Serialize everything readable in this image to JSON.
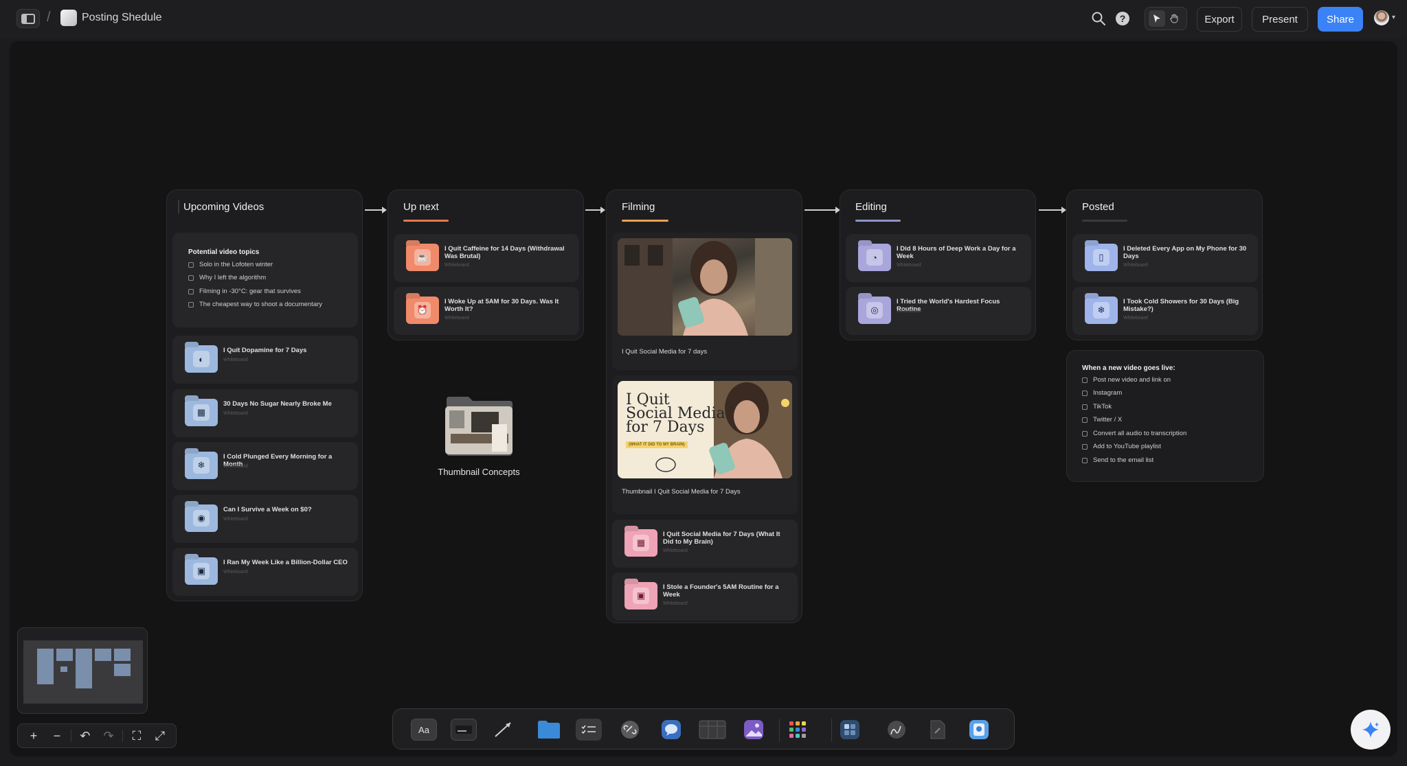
{
  "topbar": {
    "title": "Posting Shedule",
    "export_label": "Export",
    "present_label": "Present",
    "share_label": "Share"
  },
  "columns": {
    "upcoming": {
      "title": "Upcoming Videos",
      "note": {
        "title": "Potential video topics",
        "items": [
          "Solo in the Lofoten winter",
          "Why I left the algorithm",
          "Filming in -30°C: gear that survives",
          "The cheapest way to shoot a documentary"
        ]
      },
      "cards": [
        {
          "title": "I Quit Dopamine for 7 Days",
          "sub": "Whiteboard"
        },
        {
          "title": "30 Days No Sugar Nearly Broke Me",
          "sub": "Whiteboard"
        },
        {
          "title": "I Cold Plunged Every Morning for a Month",
          "sub": "Whiteboard"
        },
        {
          "title": "Can I Survive a Week on $0?",
          "sub": "Whiteboard"
        },
        {
          "title": "I Ran My Week Like a Billion-Dollar CEO",
          "sub": "Whiteboard"
        }
      ]
    },
    "upnext": {
      "title": "Up next",
      "underline_color": "#e8774f",
      "cards": [
        {
          "title": "I Quit Caffeine for 14 Days (Withdrawal Was Brutal)",
          "sub": "Whiteboard"
        },
        {
          "title": "I Woke Up at 5AM for 30 Days. Was It Worth It?",
          "sub": "Whiteboard"
        }
      ]
    },
    "filming": {
      "title": "Filming",
      "underline_color": "#e8a44f",
      "photo1_caption": "I Quit Social Media for 7 days",
      "photo2_caption": "Thumbnail I Quit Social Media for 7 Days",
      "thumb_text_line1": "I Quit",
      "thumb_text_line2": "Social Media",
      "thumb_text_line3": "for 7 Days",
      "thumb_tag": "(WHAT IT DID TO MY BRAIN)",
      "cards": [
        {
          "title": "I Quit Social Media for 7 Days (What It Did to My Brain)",
          "sub": "Whiteboard"
        },
        {
          "title": "I Stole a Founder's 5AM Routine for a Week",
          "sub": "Whiteboard"
        }
      ]
    },
    "editing": {
      "title": "Editing",
      "underline_color": "#8f95c9",
      "cards": [
        {
          "title": "I Did 8 Hours of Deep Work a Day for a Week",
          "sub": "Whiteboard"
        },
        {
          "title": "I Tried the World's Hardest Focus Routine",
          "sub": "Whiteboard"
        }
      ]
    },
    "posted": {
      "title": "Posted",
      "underline_color": "#3a3a3c",
      "cards": [
        {
          "title": "I Deleted Every App on My Phone for 30 Days",
          "sub": "Whiteboard"
        },
        {
          "title": "I Took Cold Showers for 30 Days (Big Mistake?)",
          "sub": "Whiteboard"
        }
      ],
      "note": {
        "title": "When a new video goes live:",
        "items": [
          "Post new video and link on",
          "Instagram",
          "TikTok",
          "Twitter / X",
          "Convert all audio to transcription",
          "Add to YouTube playlist",
          "Send to the email list"
        ]
      }
    }
  },
  "floating_folder": {
    "label": "Thumbnail Concepts"
  },
  "dock": {
    "text_tool_label": "Aa"
  },
  "colors": {
    "accent": "#3b82f6",
    "folder_blue": "#9db8de",
    "folder_orange": "#f08a6a",
    "folder_pink": "#eea3b6",
    "folder_lavender": "#a9a6dc"
  }
}
